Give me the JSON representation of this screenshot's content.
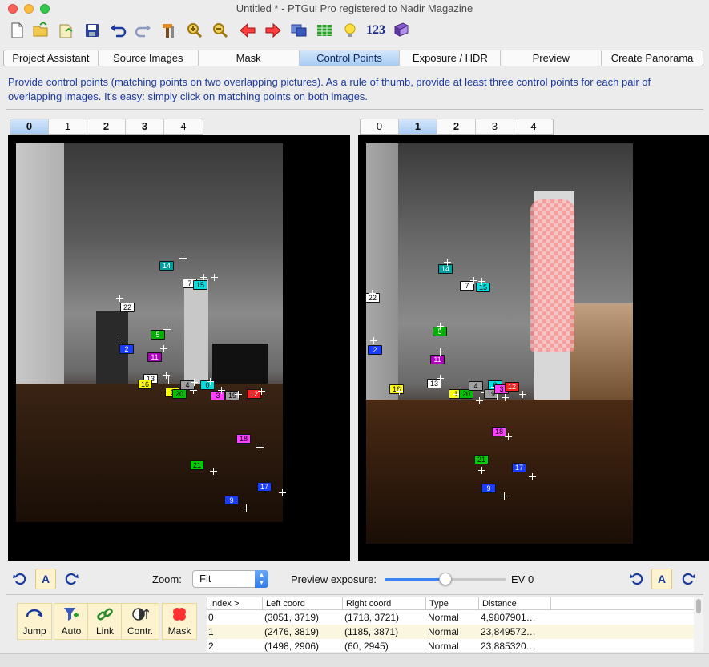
{
  "window": {
    "title": "Untitled * - PTGui Pro registered to Nadir Magazine"
  },
  "toolbar": {
    "buttons": [
      "new-icon",
      "open-icon",
      "open-recent-icon",
      "save-icon",
      "undo-icon",
      "redo-icon",
      "tools-icon",
      "zoom-in-icon",
      "zoom-out-icon",
      "prev-icon",
      "next-icon",
      "panorama-editor-icon",
      "table-icon",
      "bulb-icon",
      "numbers-icon",
      "book-icon"
    ],
    "numbers_label": "123"
  },
  "tabs": [
    "Project Assistant",
    "Source Images",
    "Mask",
    "Control Points",
    "Exposure / HDR",
    "Preview",
    "Create Panorama"
  ],
  "active_tab": "Control Points",
  "instructions": "Provide control points (matching points on two overlapping pictures). As a rule of thumb, provide at least three control points for each pair of overlapping images. It's easy: simply click on matching points on both images.",
  "left_image_tabs": [
    "0",
    "1",
    "2",
    "3",
    "4"
  ],
  "left_active": "0",
  "right_image_tabs": [
    "0",
    "1",
    "2",
    "3",
    "4"
  ],
  "right_active": "1",
  "controls": {
    "zoom_label": "Zoom:",
    "zoom_value": "Fit",
    "preview_exposure_label": "Preview exposure:",
    "exposure_fraction": 0.5,
    "ev_label": "EV 0",
    "auto_label": "A"
  },
  "actions": [
    {
      "label": "Jump",
      "icon": "jump-icon"
    },
    {
      "label": "Auto",
      "icon": "auto-icon"
    },
    {
      "label": "Link",
      "icon": "link-icon"
    },
    {
      "label": "Contr.",
      "icon": "contrast-icon"
    },
    {
      "label": "Mask",
      "icon": "mask-icon"
    }
  ],
  "table": {
    "headers": [
      "Index >",
      "Left coord",
      "Right coord",
      "Type",
      "Distance"
    ],
    "rows": [
      [
        "0",
        "(3051, 3719)",
        "(1718, 3721)",
        "Normal",
        "4,9807901…"
      ],
      [
        "1",
        "(2476, 3819)",
        "(1185, 3871)",
        "Normal",
        "23,849572…"
      ],
      [
        "2",
        "(1498, 2906)",
        "(60, 2945)",
        "Normal",
        "23,885320…"
      ]
    ]
  },
  "colors": {
    "accent": "#3b82f6",
    "instructions": "#1a3aa0"
  },
  "left_points": [
    {
      "n": "14",
      "c": "#00a0a0"
    },
    {
      "n": "7",
      "c": "#ffffff"
    },
    {
      "n": "15",
      "c": "#00e0e0"
    },
    {
      "n": "22",
      "c": "#ffffff"
    },
    {
      "n": "2",
      "c": "#1a3cff"
    },
    {
      "n": "5",
      "c": "#00b000"
    },
    {
      "n": "11",
      "c": "#b000c0"
    },
    {
      "n": "13",
      "c": "#ffffff"
    },
    {
      "n": "16",
      "c": "#ffff00"
    },
    {
      "n": "1",
      "c": "#ffff00"
    },
    {
      "n": "20",
      "c": "#00c000"
    },
    {
      "n": "4",
      "c": "#a0a0a0"
    },
    {
      "n": "0",
      "c": "#00e0e0"
    },
    {
      "n": "3",
      "c": "#ff40ff"
    },
    {
      "n": "19",
      "c": "#a0a0a0"
    },
    {
      "n": "12",
      "c": "#ff2020"
    },
    {
      "n": "18",
      "c": "#ff40ff"
    },
    {
      "n": "21",
      "c": "#00d000"
    },
    {
      "n": "17",
      "c": "#1a3cff"
    },
    {
      "n": "9",
      "c": "#1a3cff"
    }
  ],
  "right_points": [
    {
      "n": "14",
      "c": "#00a0a0"
    },
    {
      "n": "7",
      "c": "#ffffff"
    },
    {
      "n": "15",
      "c": "#00e0e0"
    },
    {
      "n": "22",
      "c": "#ffffff"
    },
    {
      "n": "2",
      "c": "#1a3cff"
    },
    {
      "n": "5",
      "c": "#00b000"
    },
    {
      "n": "11",
      "c": "#b000c0"
    },
    {
      "n": "13",
      "c": "#ffffff"
    },
    {
      "n": "16",
      "c": "#ffff00"
    },
    {
      "n": "1",
      "c": "#ffff00"
    },
    {
      "n": "20",
      "c": "#00c000"
    },
    {
      "n": "4",
      "c": "#a0a0a0"
    },
    {
      "n": "0",
      "c": "#00e0e0"
    },
    {
      "n": "19",
      "c": "#a0a0a0"
    },
    {
      "n": "3",
      "c": "#ff40ff"
    },
    {
      "n": "12",
      "c": "#ff2020"
    },
    {
      "n": "18",
      "c": "#ff40ff"
    },
    {
      "n": "21",
      "c": "#00d000"
    },
    {
      "n": "17",
      "c": "#1a3cff"
    },
    {
      "n": "9",
      "c": "#1a3cff"
    }
  ]
}
